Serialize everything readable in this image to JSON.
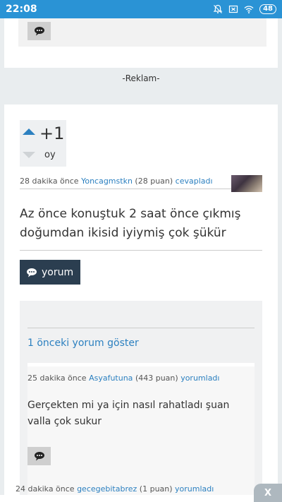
{
  "status_bar": {
    "time": "22:08",
    "battery": "48"
  },
  "ad_label": "-Reklam-",
  "answer": {
    "vote_count": "+1",
    "vote_label": "oy",
    "time_ago": "28 dakika önce",
    "user": "Yoncagmstkn",
    "points": "(28 puan)",
    "action": "cevapladı",
    "text": "Az önce konuştuk 2 saat önce çıkmış doğumdan ikisid iyiymiş çok şükür",
    "comment_button_label": "yorum"
  },
  "comments": {
    "show_previous": "1 önceki yorum göster",
    "items": [
      {
        "time_ago": "25 dakika önce",
        "user": "Asyafutuna",
        "points": "(443 puan)",
        "action": "yorumladı",
        "text": "Gerçekten mi ya için nasıl rahatladı şuan valla çok sukur"
      }
    ],
    "truncated_meta": {
      "time_ago": "24 dakika önce",
      "user": "gecegebitabrez",
      "points": "(1 puan)",
      "action": "yorumladı"
    }
  },
  "close_label": "X",
  "colors": {
    "accent": "#2c80c0",
    "dark_button": "#2b3e50",
    "status_bar": "#2a93d5"
  }
}
